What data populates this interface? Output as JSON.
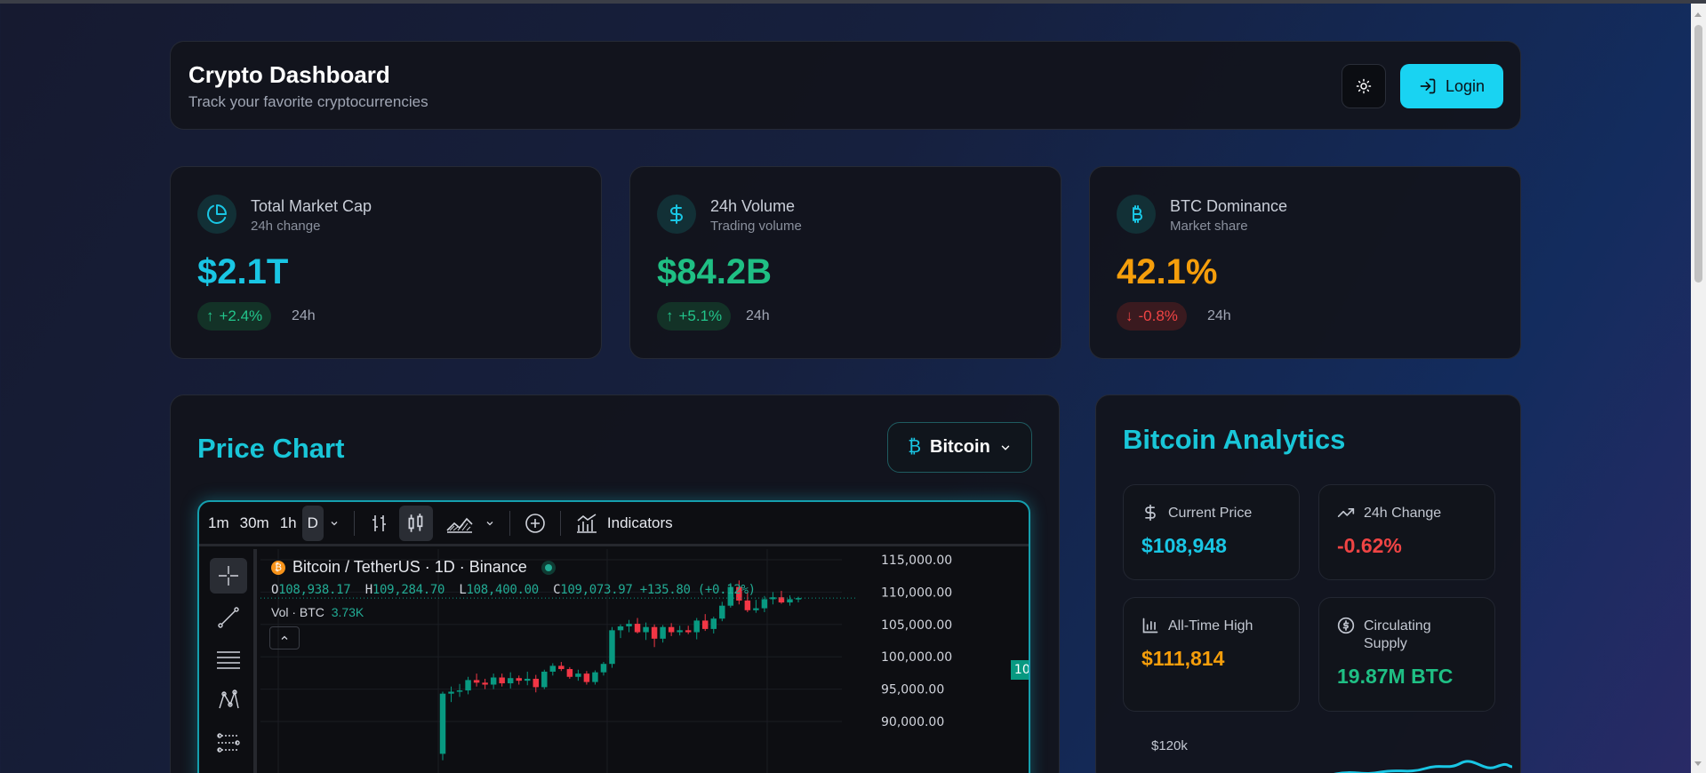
{
  "header": {
    "title": "Crypto Dashboard",
    "subtitle": "Track your favorite cryptocurrencies",
    "theme_icon": "sun-icon",
    "login_label": "Login",
    "login_icon": "login-icon"
  },
  "stats": [
    {
      "title": "Total Market Cap",
      "subtitle": "24h change",
      "value": "$2.1T",
      "change": "+2.4%",
      "direction": "up",
      "period": "24h",
      "icon": "pie-chart-icon",
      "color": "#19c6e4"
    },
    {
      "title": "24h Volume",
      "subtitle": "Trading volume",
      "value": "$84.2B",
      "change": "+5.1%",
      "direction": "up",
      "period": "24h",
      "icon": "dollar-icon",
      "color": "#1fbf84"
    },
    {
      "title": "BTC Dominance",
      "subtitle": "Market share",
      "value": "42.1%",
      "change": "-0.8%",
      "direction": "down",
      "period": "24h",
      "icon": "bitcoin-icon",
      "color": "#f59e0b"
    }
  ],
  "price_chart": {
    "title": "Price Chart",
    "coin_select": "Bitcoin",
    "toolbar": {
      "intervals": [
        "1m",
        "30m",
        "1h",
        "D"
      ],
      "active_interval": "D",
      "indicators_label": "Indicators"
    },
    "legend": {
      "symbol": "Bitcoin / TetherUS · 1D · Binance",
      "o_label": "O",
      "o": "108,938.17",
      "h_label": "H",
      "h": "109,284.70",
      "l_label": "L",
      "l": "108,400.00",
      "c_label": "C",
      "c": "109,073.97",
      "change": "+135.80 (+0.12%)",
      "vol_label": "Vol · BTC",
      "vol": "3.73K"
    },
    "last_price": "109,073.97",
    "colors": {
      "up": "#089981",
      "down": "#f23645"
    }
  },
  "chart_data": {
    "type": "candlestick",
    "y_ticks": [
      "115,000.00",
      "110,000.00",
      "105,000.00",
      "100,000.00",
      "95,000.00",
      "90,000.00"
    ],
    "ylim": [
      89000,
      116000
    ],
    "candles": [
      {
        "o": 85000,
        "h": 94600,
        "l": 84000,
        "c": 94300
      },
      {
        "o": 94300,
        "h": 95400,
        "l": 93000,
        "c": 94600
      },
      {
        "o": 94600,
        "h": 95800,
        "l": 93800,
        "c": 94800
      },
      {
        "o": 94800,
        "h": 96900,
        "l": 94200,
        "c": 96400
      },
      {
        "o": 96400,
        "h": 97400,
        "l": 95400,
        "c": 96000
      },
      {
        "o": 96000,
        "h": 96600,
        "l": 95000,
        "c": 95700
      },
      {
        "o": 95700,
        "h": 97400,
        "l": 95000,
        "c": 96800
      },
      {
        "o": 96800,
        "h": 97400,
        "l": 95400,
        "c": 95900
      },
      {
        "o": 95900,
        "h": 97600,
        "l": 95100,
        "c": 96700
      },
      {
        "o": 96700,
        "h": 97100,
        "l": 95700,
        "c": 96300
      },
      {
        "o": 96300,
        "h": 97700,
        "l": 95600,
        "c": 96600
      },
      {
        "o": 96600,
        "h": 97200,
        "l": 94500,
        "c": 95300
      },
      {
        "o": 95300,
        "h": 98000,
        "l": 95000,
        "c": 97700
      },
      {
        "o": 97700,
        "h": 99000,
        "l": 97100,
        "c": 98600
      },
      {
        "o": 98600,
        "h": 99200,
        "l": 97800,
        "c": 98100
      },
      {
        "o": 98100,
        "h": 98400,
        "l": 96600,
        "c": 96900
      },
      {
        "o": 96900,
        "h": 98000,
        "l": 96300,
        "c": 97400
      },
      {
        "o": 97400,
        "h": 97800,
        "l": 95700,
        "c": 96100
      },
      {
        "o": 96100,
        "h": 97900,
        "l": 95700,
        "c": 97600
      },
      {
        "o": 97600,
        "h": 99200,
        "l": 97100,
        "c": 98900
      },
      {
        "o": 98900,
        "h": 104600,
        "l": 98300,
        "c": 104100
      },
      {
        "o": 104100,
        "h": 105000,
        "l": 102900,
        "c": 104700
      },
      {
        "o": 104700,
        "h": 105700,
        "l": 103800,
        "c": 105100
      },
      {
        "o": 105100,
        "h": 106000,
        "l": 103600,
        "c": 103800
      },
      {
        "o": 103800,
        "h": 105300,
        "l": 102600,
        "c": 104600
      },
      {
        "o": 104600,
        "h": 105000,
        "l": 101500,
        "c": 102800
      },
      {
        "o": 102800,
        "h": 104900,
        "l": 102200,
        "c": 104600
      },
      {
        "o": 104600,
        "h": 105200,
        "l": 103200,
        "c": 103800
      },
      {
        "o": 103800,
        "h": 104800,
        "l": 103300,
        "c": 104100
      },
      {
        "o": 104100,
        "h": 104800,
        "l": 103500,
        "c": 103800
      },
      {
        "o": 103800,
        "h": 106000,
        "l": 102700,
        "c": 105600
      },
      {
        "o": 105600,
        "h": 106600,
        "l": 104000,
        "c": 104300
      },
      {
        "o": 104300,
        "h": 106200,
        "l": 103600,
        "c": 105900
      },
      {
        "o": 105900,
        "h": 108500,
        "l": 105500,
        "c": 107900
      },
      {
        "o": 107900,
        "h": 111400,
        "l": 107600,
        "c": 110800
      },
      {
        "o": 110800,
        "h": 111800,
        "l": 108100,
        "c": 108700
      },
      {
        "o": 108700,
        "h": 110000,
        "l": 106900,
        "c": 107200
      },
      {
        "o": 107200,
        "h": 108800,
        "l": 106800,
        "c": 107500
      },
      {
        "o": 107500,
        "h": 109400,
        "l": 106900,
        "c": 108900
      },
      {
        "o": 108900,
        "h": 110000,
        "l": 108100,
        "c": 109200
      },
      {
        "o": 109200,
        "h": 110200,
        "l": 108200,
        "c": 108400
      },
      {
        "o": 108400,
        "h": 109500,
        "l": 107900,
        "c": 108900
      },
      {
        "o": 108938.17,
        "h": 109284.7,
        "l": 108400,
        "c": 109073.97
      }
    ]
  },
  "analytics": {
    "title": "Bitcoin Analytics",
    "tiles": [
      {
        "label": "Current Price",
        "value": "$108,948",
        "icon": "dollar-icon",
        "color": "#19c6e4"
      },
      {
        "label": "24h Change",
        "value": "-0.62%",
        "icon": "trending-up-icon",
        "color": "#ef4444"
      },
      {
        "label": "All-Time High",
        "value": "$111,814",
        "icon": "bar-chart-icon",
        "color": "#f59e0b"
      },
      {
        "label": "Circulating Supply",
        "value": "19.87M BTC",
        "icon": "coin-icon",
        "color": "#1fbf84"
      }
    ],
    "mini_chart_label": "$120k",
    "mini_chart_color": "#19c6e4"
  }
}
